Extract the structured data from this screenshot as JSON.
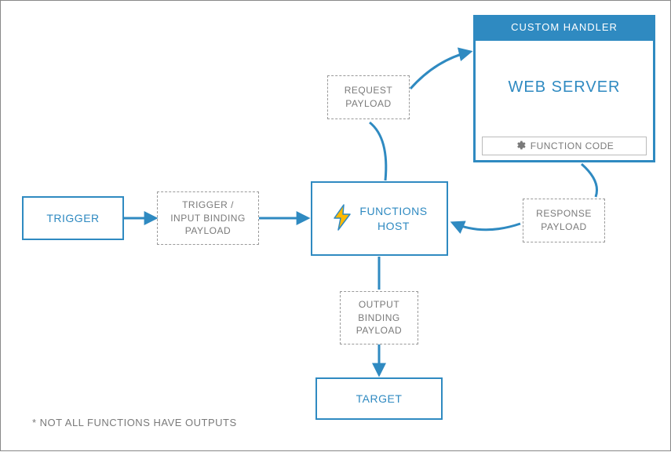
{
  "diagram": {
    "trigger": "TRIGGER",
    "trigger_payload": "TRIGGER /\nINPUT BINDING\nPAYLOAD",
    "functions_host": "FUNCTIONS\nHOST",
    "request_payload": "REQUEST\nPAYLOAD",
    "response_payload": "RESPONSE\nPAYLOAD",
    "output_payload": "OUTPUT\nBINDING\nPAYLOAD",
    "target": "TARGET",
    "custom_handler_header": "CUSTOM HANDLER",
    "web_server": "WEB SERVER",
    "function_code": "FUNCTION CODE",
    "footnote": "* NOT ALL FUNCTIONS HAVE OUTPUTS"
  },
  "colors": {
    "primary": "#2F8AC1",
    "muted": "#7a7a7a",
    "dashed_border": "#9a9a9a"
  }
}
